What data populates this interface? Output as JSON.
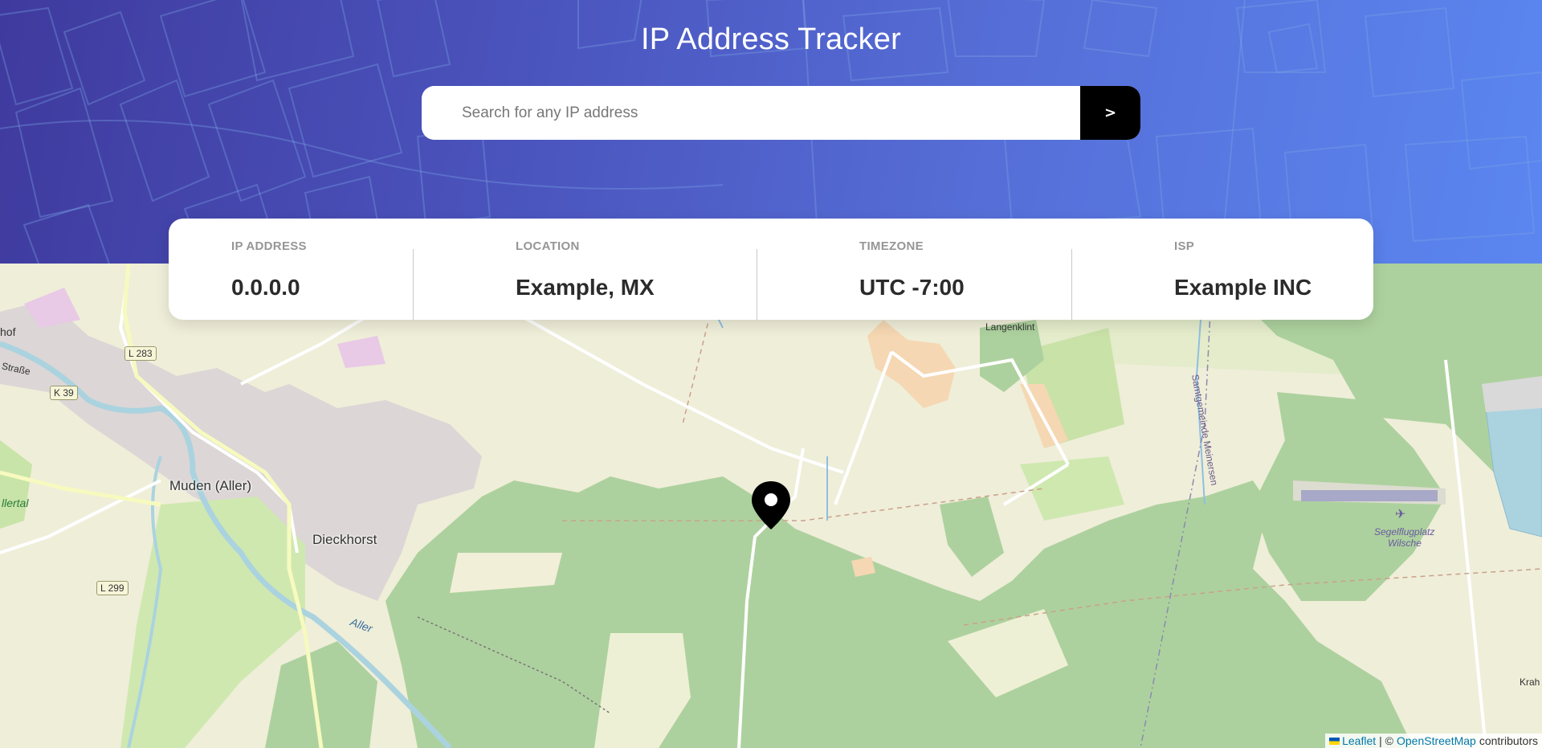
{
  "header": {
    "title": "IP Address Tracker",
    "search": {
      "placeholder": "Search for any IP address",
      "value": "",
      "submit_label": ">"
    }
  },
  "info": {
    "ip_label": "IP ADDRESS",
    "ip_value": "0.0.0.0",
    "location_label": "LOCATION",
    "location_value": "Example, MX",
    "timezone_label": "TIMEZONE",
    "timezone_value": "UTC -7:00",
    "isp_label": "ISP",
    "isp_value": "Example INC"
  },
  "map": {
    "marker_icon": "location-pin-icon",
    "place_labels": {
      "muden": "Muden (Aller)",
      "dieckhorst": "Dieckhorst",
      "langenklint": "Langenklint",
      "segelflugplatz": "Segelflugplatz",
      "wilsche": "Wilsche",
      "aller": "Aller",
      "allertal": "llertal",
      "strasse": "Straße",
      "hof": "hof",
      "meinersen": "Samtgemeinde Meinersen",
      "krah": "Krah"
    },
    "road_shields": {
      "l283": "L 283",
      "k39": "K 39",
      "l299": "L 299"
    },
    "attribution": {
      "leaflet": "Leaflet",
      "separator": "| ©",
      "osm": "OpenStreetMap",
      "contributors": "contributors"
    }
  },
  "colors": {
    "header_start": "#3f3a9e",
    "header_end": "#5b86f0",
    "button": "#000000",
    "forest": "#add19e",
    "farmland": "#eef0d5"
  }
}
